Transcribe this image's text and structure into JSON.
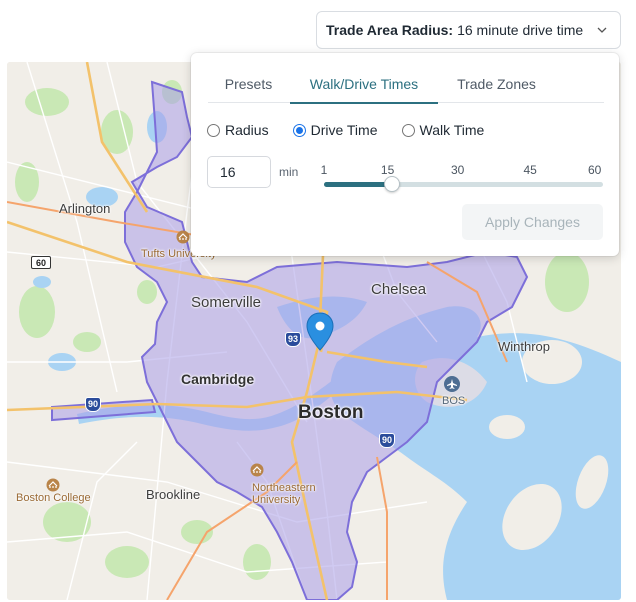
{
  "trade_area": {
    "label": "Trade Area Radius:",
    "value": "16 minute drive time",
    "icon": "chevron-down-icon"
  },
  "tabs": [
    {
      "label": "Presets",
      "active": false
    },
    {
      "label": "Walk/Drive Times",
      "active": true
    },
    {
      "label": "Trade Zones",
      "active": false
    }
  ],
  "modes": [
    {
      "label": "Radius",
      "checked": false
    },
    {
      "label": "Drive Time",
      "checked": true
    },
    {
      "label": "Walk Time",
      "checked": false
    }
  ],
  "minutes": {
    "value": "16",
    "unit": "min"
  },
  "slider": {
    "min": 1,
    "max": 60,
    "value": 16,
    "ticks": [
      "1",
      "15",
      "30",
      "45",
      "60"
    ]
  },
  "apply_button": {
    "label": "Apply Changes",
    "disabled": true
  },
  "map": {
    "places": {
      "arlington": "Arlington",
      "somerville": "Somerville",
      "chelsea": "Chelsea",
      "winthrop": "Winthrop",
      "cambridge": "Cambridge",
      "boston": "Boston",
      "bos": "BOS",
      "brookline": "Brookline",
      "boston_college": "Boston College",
      "tufts": "Tufts University",
      "northeastern_1": "Northeastern",
      "northeastern_2": "University"
    },
    "shields": {
      "route_60": "60",
      "i93": "93",
      "i90_west": "90",
      "i90_east": "90"
    },
    "colors": {
      "water": "#a9d3f3",
      "trade_area_fill": "#a99ee8",
      "trade_area_outline": "#7d6fd9",
      "park": "#c9e8b5",
      "pin": "#2a8fe0"
    },
    "icons": [
      "location-pin-icon",
      "airport-icon",
      "university-icon"
    ]
  }
}
